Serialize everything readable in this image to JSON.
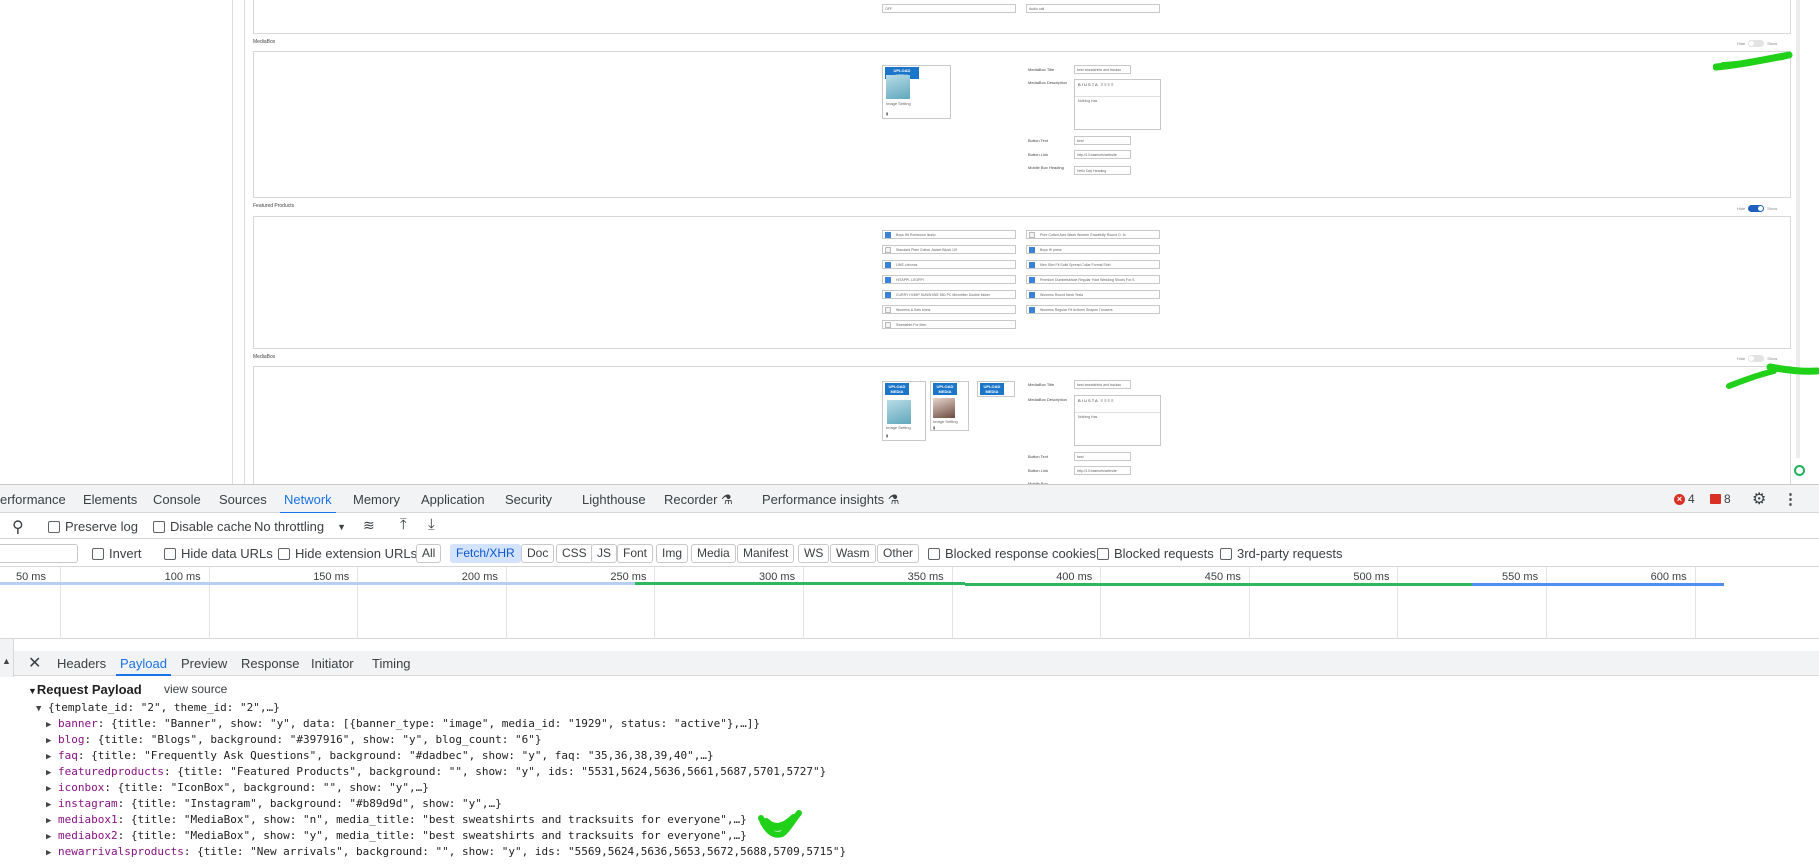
{
  "app": {
    "sections": [
      {
        "title": "MediaBox",
        "toggle": {
          "hide": "Hide",
          "show": "Show",
          "on": false
        }
      },
      {
        "title": "Featured Products",
        "toggle": {
          "hide": "Hide",
          "show": "Show",
          "on": true
        }
      },
      {
        "title": "MediaBox",
        "toggle": {
          "hide": "Hide",
          "show": "Show",
          "on": false
        }
      }
    ],
    "top_inputs": [
      "OFF",
      "Audio call"
    ],
    "mediabox1": {
      "upload_label": "UPLOAD MEDIA",
      "caption": "Image Setting",
      "fields": {
        "title_label": "MediaBox Title",
        "title_value": "best sweatshirts and tracksu",
        "desc_label": "MediaBox Description",
        "desc_text": "Nothing Has",
        "button_text_label": "Button Text",
        "button_text_value": "best",
        "button_link_label": "Button Link",
        "button_link_value": "http://13.baseurls/website",
        "mobile_label": "Mobile Box Heading",
        "mobile_value": "Hello Day Heading"
      }
    },
    "products_left": [
      "Boys Hit Romwooo Ikonic",
      "Standard Plain Cotton Jacket Blush 10f",
      "LINE-chronos",
      "HITAPPL LEOPPI",
      "CURRY HOMP SUNSHINE 850 PC Microfiber Double bicker",
      "Womens & Sets binns",
      "Sweatshirt For Men"
    ],
    "products_left_checked": [
      true,
      false,
      true,
      true,
      true,
      false,
      false
    ],
    "products_right": [
      "Pure Cotton Acid Wash Women Gracefully Round O. Ib",
      "Boys Hi press",
      "Men Slim Fit Solid Spread Collar Formal Shirt",
      "Premium Dumbelsbhole Regular Yoke Wedding Shorts For S",
      "Womens Round Neck Tesla",
      "Womens Regular Fit Uniform Shapes Trousers"
    ],
    "products_right_checked": [
      false,
      true,
      true,
      true,
      true,
      true
    ],
    "mediabox2": {
      "upload_label": "UPLOAD MEDIA",
      "caption1": "Image Setting",
      "caption2": "Image Setting",
      "fields": {
        "title_label": "MediaBox Title",
        "title_value": "best sweatshirts and tracksu",
        "desc_label": "MediaBox Description",
        "desc_text": "Nothing Has",
        "button_text_label": "Button Text",
        "button_text_value": "best",
        "button_link_label": "Button Link",
        "button_link_value": "http://13.baseurls/website",
        "mobile_label": "Mobile Box"
      }
    }
  },
  "devtools": {
    "tabs": [
      "erformance",
      "Elements",
      "Console",
      "Sources",
      "Network",
      "Memory",
      "Application",
      "Security",
      "Lighthouse",
      "Recorder",
      "Performance insights"
    ],
    "active_tab": "Network",
    "errors": "4",
    "issues": "8",
    "toolbar": {
      "preserve_log": "Preserve log",
      "disable_cache": "Disable cache",
      "throttling": "No throttling"
    },
    "filter": {
      "invert": "Invert",
      "hide_data_urls": "Hide data URLs",
      "hide_extension_urls": "Hide extension URLs",
      "chips": [
        "All",
        "Fetch/XHR",
        "Doc",
        "CSS",
        "JS",
        "Font",
        "Img",
        "Media",
        "Manifest",
        "WS",
        "Wasm",
        "Other"
      ],
      "selected_chip": "Fetch/XHR",
      "blocked_cookies": "Blocked response cookies",
      "blocked_requests": "Blocked requests",
      "third_party": "3rd-party requests"
    },
    "timeline_ticks": [
      "50 ms",
      "100 ms",
      "150 ms",
      "200 ms",
      "250 ms",
      "300 ms",
      "350 ms",
      "400 ms",
      "450 ms",
      "500 ms",
      "550 ms",
      "600 ms"
    ],
    "panel_tabs": [
      "Headers",
      "Payload",
      "Preview",
      "Response",
      "Initiator",
      "Timing"
    ],
    "active_panel_tab": "Payload",
    "payload": {
      "title": "Request Payload",
      "view_source": "view source",
      "root": "{template_id: \"2\", theme_id: \"2\",…}",
      "entries": [
        {
          "key": "banner",
          "value": "{title: \"Banner\", show: \"y\", data: [{banner_type: \"image\", media_id: \"1929\", status: \"active\"},…]}"
        },
        {
          "key": "blog",
          "value": "{title: \"Blogs\", background: \"#397916\", show: \"y\", blog_count: \"6\"}"
        },
        {
          "key": "faq",
          "value": "{title: \"Frequently Ask Questions\", background: \"#dadbec\", show: \"y\", faq: \"35,36,38,39,40\",…}"
        },
        {
          "key": "featuredproducts",
          "value": "{title: \"Featured Products\", background: \"\", show: \"y\", ids: \"5531,5624,5636,5661,5687,5701,5727\"}"
        },
        {
          "key": "iconbox",
          "value": "{title: \"IconBox\", background: \"\", show: \"y\",…}"
        },
        {
          "key": "instagram",
          "value": "{title: \"Instagram\", background: \"#b89d9d\", show: \"y\",…}"
        },
        {
          "key": "mediabox1",
          "value": "{title: \"MediaBox\", show: \"n\", media_title: \"best sweatshirts and tracksuits for everyone\",…}"
        },
        {
          "key": "mediabox2",
          "value": "{title: \"MediaBox\", show: \"y\", media_title: \"best sweatshirts and tracksuits for everyone\",…}"
        },
        {
          "key": "newarrivalsproducts",
          "value": "{title: \"New arrivals\", background: \"\", show: \"y\", ids: \"5569,5624,5636,5653,5672,5688,5709,5715\"}"
        }
      ]
    }
  },
  "colors": {
    "accent": "#1a73e8",
    "annotation": "#21d119",
    "error": "#d93025",
    "network_green": "#2fb760",
    "network_blue": "#4f8ff0"
  }
}
